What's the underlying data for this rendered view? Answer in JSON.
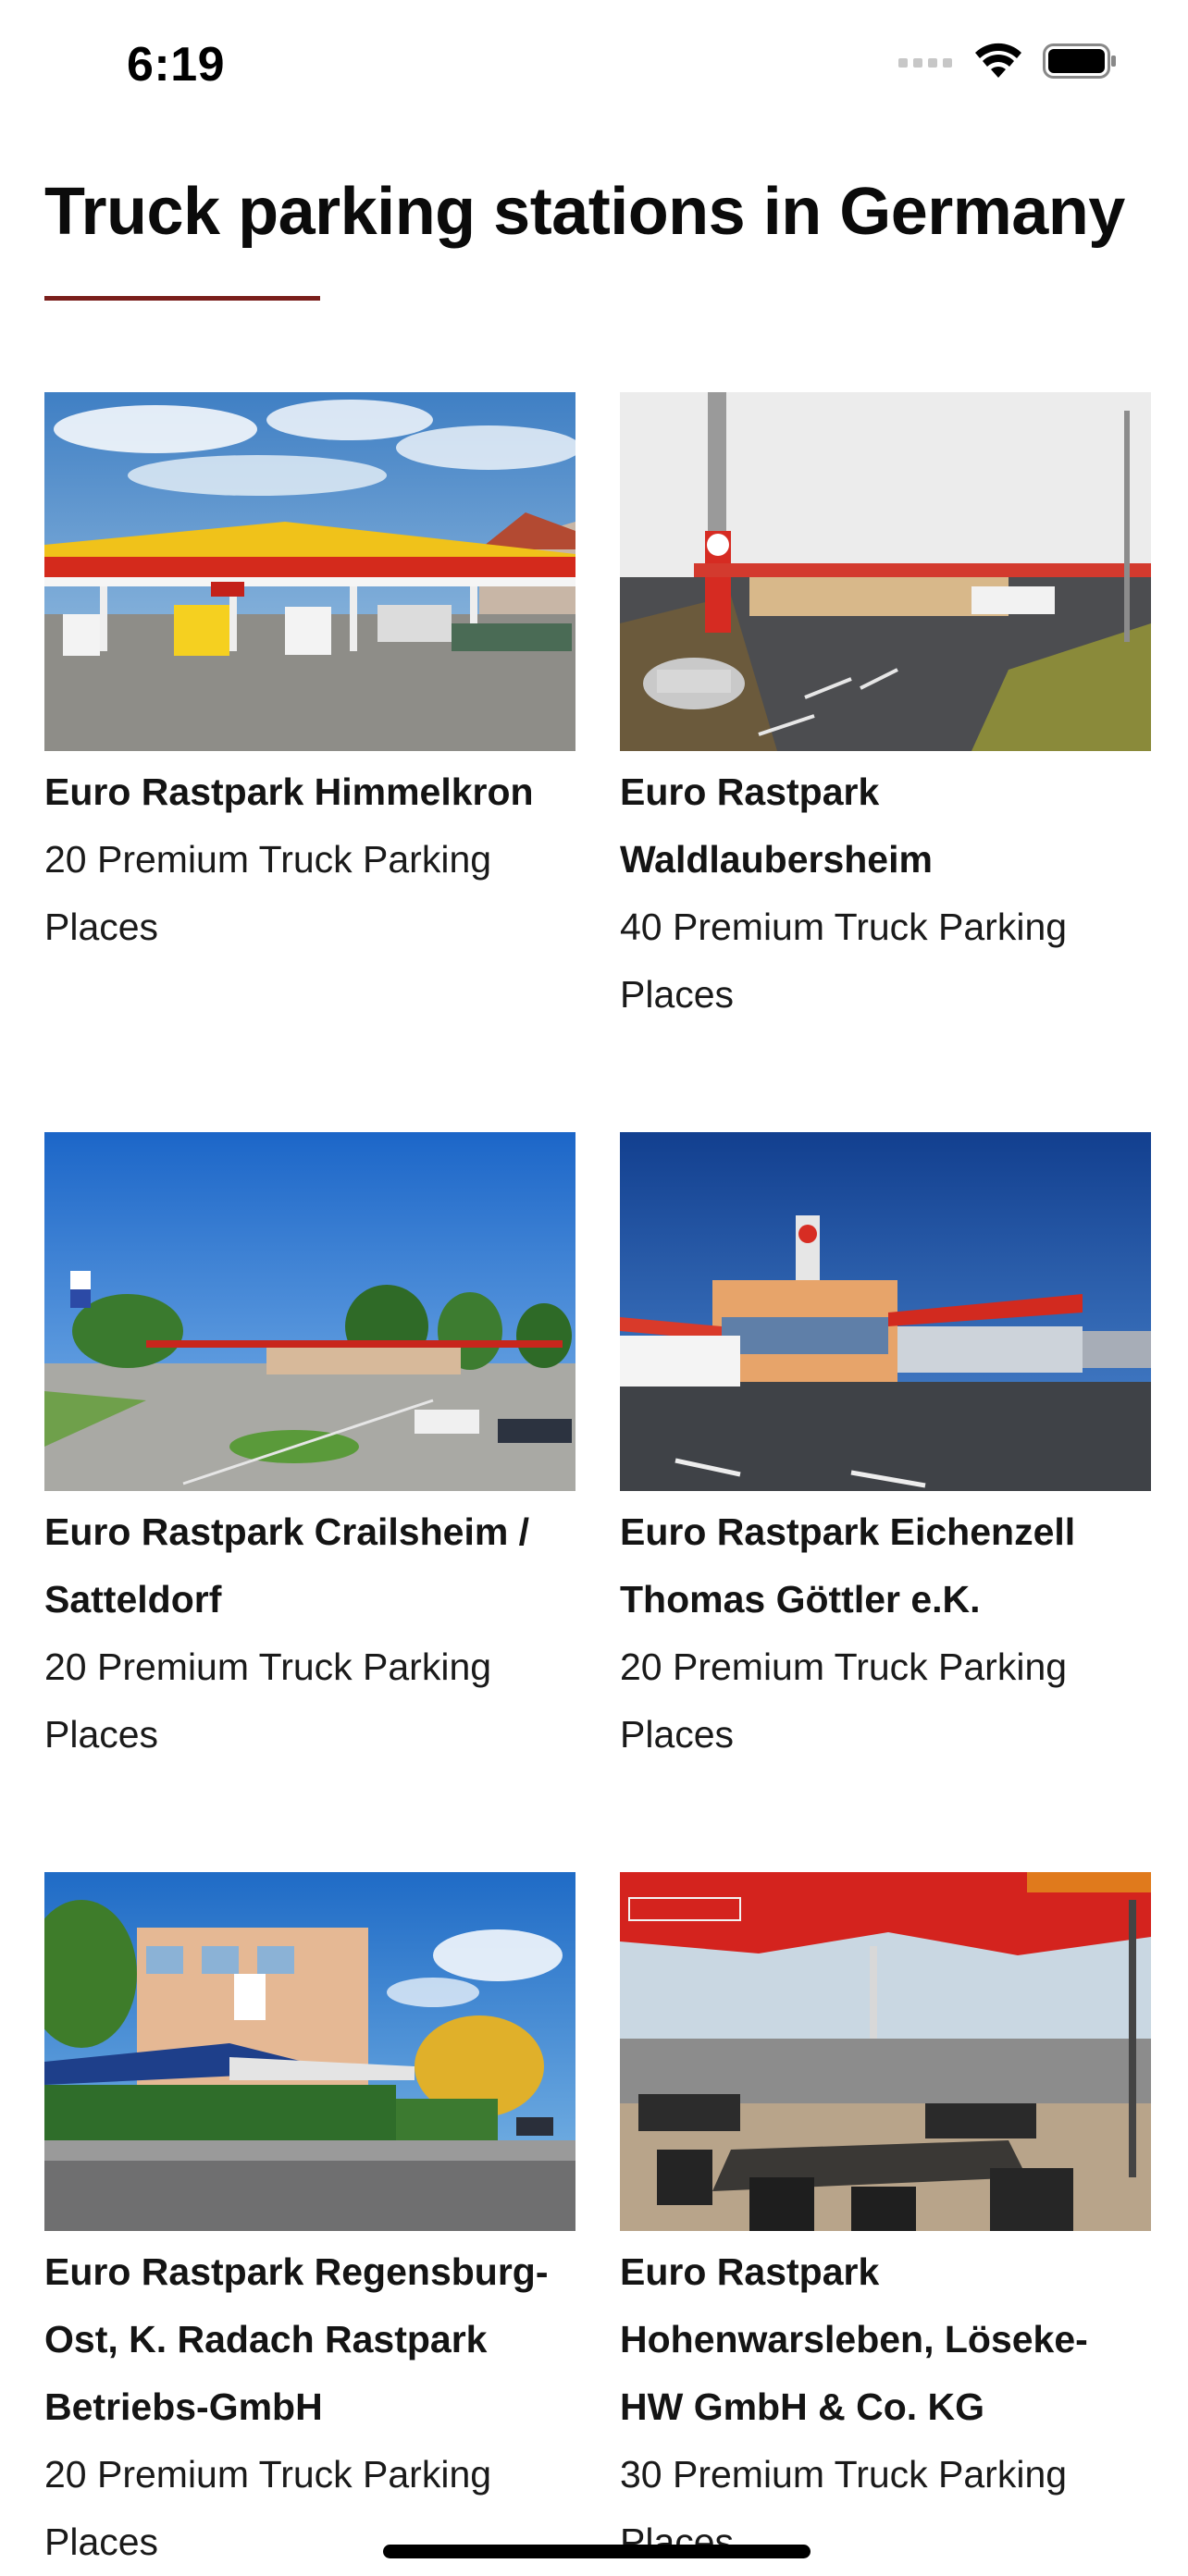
{
  "status_bar": {
    "time": "6:19"
  },
  "page": {
    "title": "Truck parking stations in Germany",
    "accent_color": "#7a1f1c"
  },
  "stations": [
    {
      "name": "Euro Rastpark Himmelkron",
      "places": "20 Premium Truck Parking Places",
      "photo_icon": "gas-station-photo"
    },
    {
      "name": "Euro Rastpark Waldlaubersheim",
      "places": "40 Premium Truck Parking Places",
      "photo_icon": "gas-station-photo"
    },
    {
      "name": "Euro Rastpark Crailsheim / Satteldorf",
      "places": "20 Premium Truck Parking Places",
      "photo_icon": "roundabout-photo"
    },
    {
      "name": "Euro Rastpark Eichenzell Thomas Göttler e.K.",
      "places": "20 Premium Truck Parking Places",
      "photo_icon": "restaurant-building-photo"
    },
    {
      "name": "Euro Rastpark Regensburg-Ost, K. Radach Rastpark Betriebs-GmbH",
      "places": "20 Premium Truck Parking Places",
      "photo_icon": "hotel-building-photo"
    },
    {
      "name": "Euro Rastpark Hohenwarsleben, Löseke-HW GmbH & Co. KG",
      "places": "30 Premium Truck Parking Places",
      "photo_icon": "terrace-photo"
    }
  ]
}
